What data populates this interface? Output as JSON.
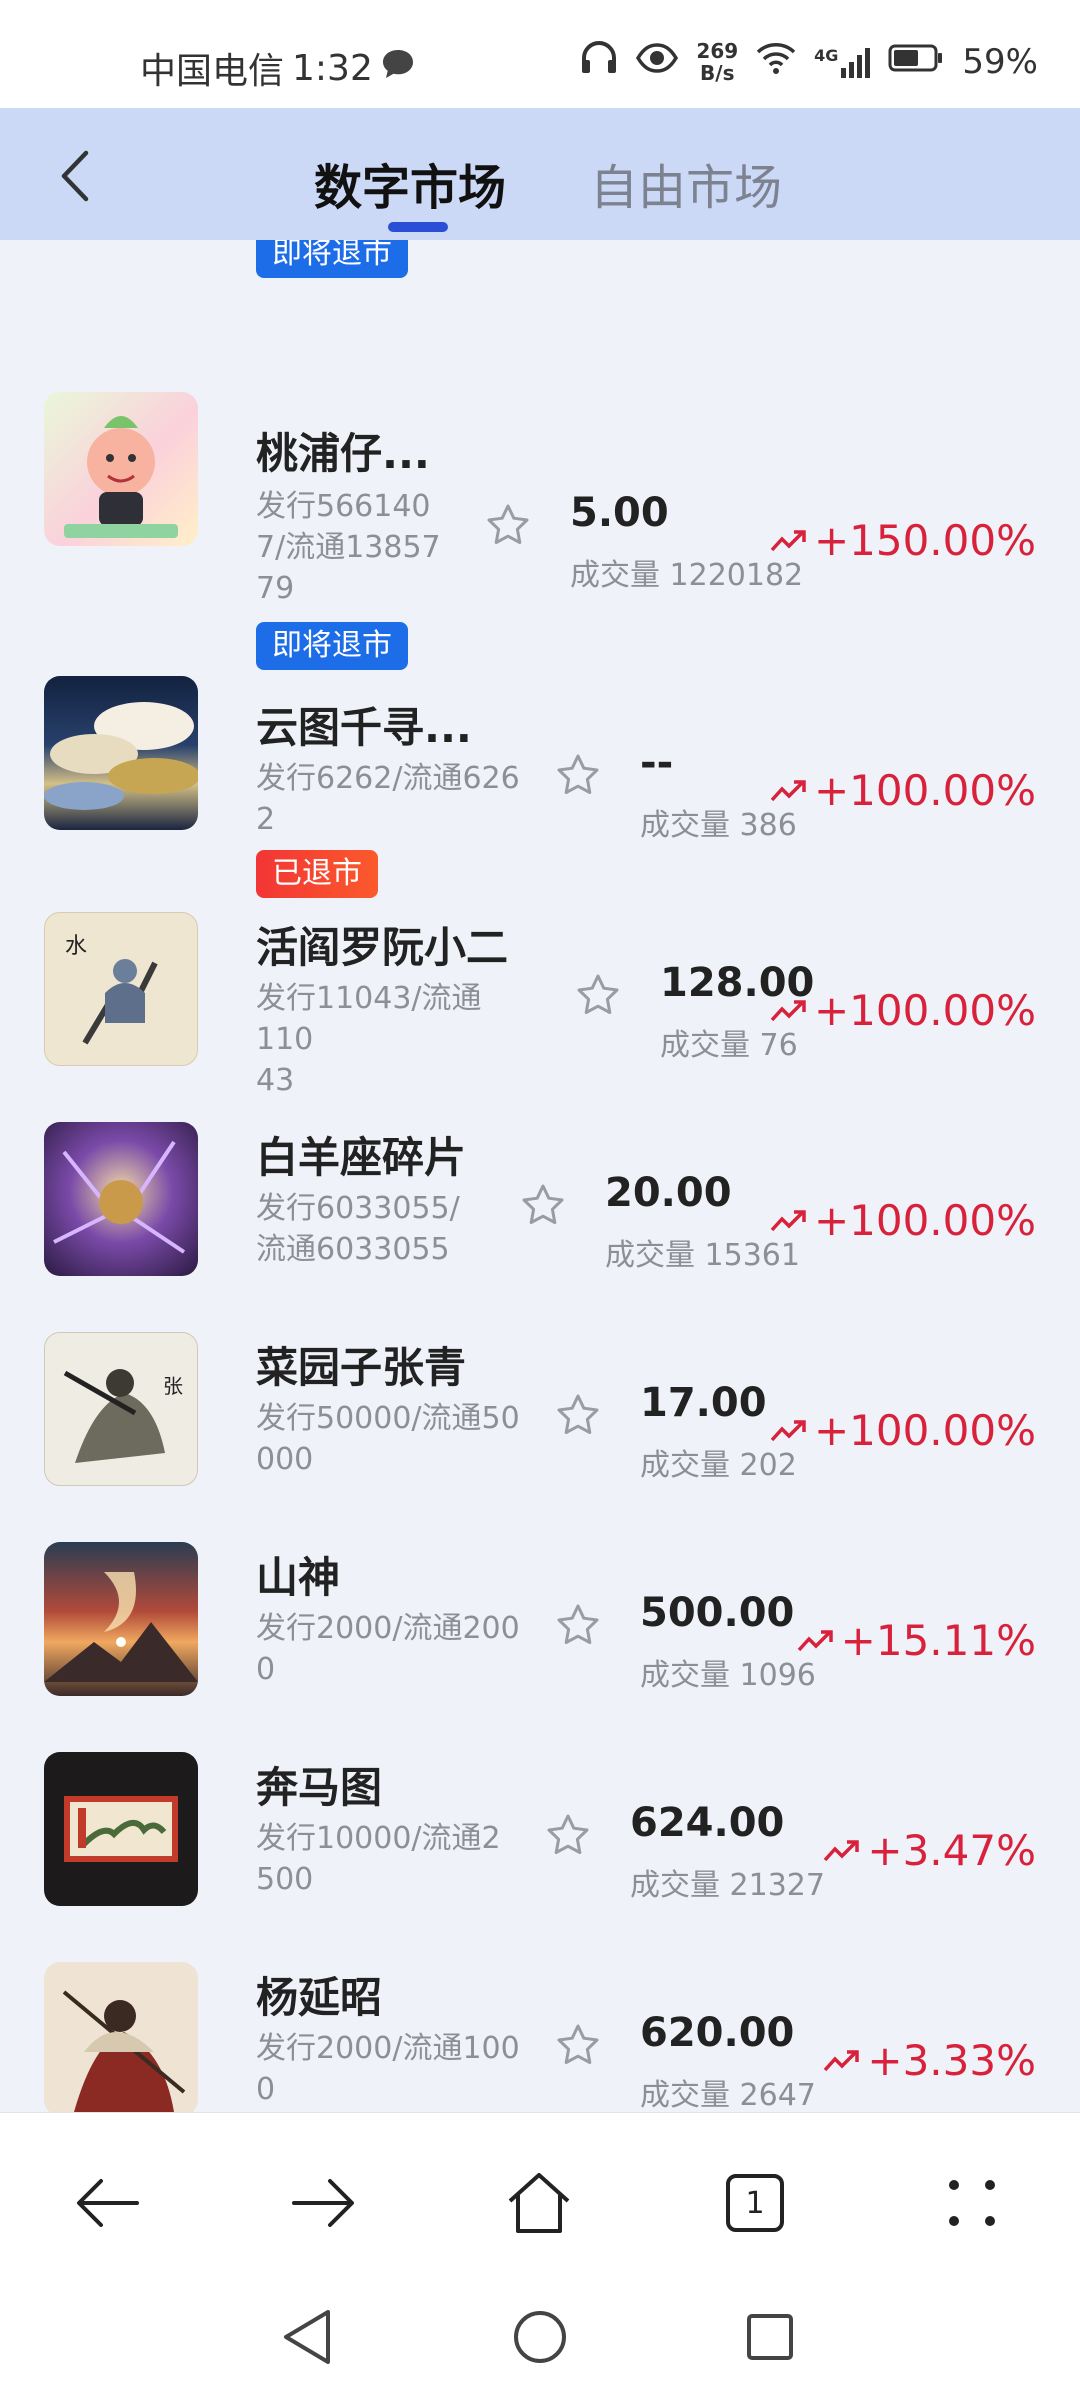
{
  "status_bar": {
    "carrier": "中国电信",
    "time": "1:32",
    "net_speed_value": "269",
    "net_speed_unit": "B/s",
    "network_type": "4G",
    "battery": "59%"
  },
  "nav": {
    "tab_active": "数字市场",
    "tab_inactive": "自由市场"
  },
  "top_partial_badge": "即将退市",
  "items": [
    {
      "name": "桃浦仔...",
      "issue": "发行566140\n7/流通13857\n79",
      "badge": "即将退市",
      "badge_type": "blue",
      "price": "5.00",
      "volume": "成交量 1220182",
      "change": "+150.00%",
      "icon": "trend-up-icon"
    },
    {
      "name": "云图千寻...",
      "issue": "发行6262/流通626\n2",
      "badge": "已退市",
      "badge_type": "red",
      "price": "--",
      "volume": "成交量 386",
      "change": "+100.00%",
      "icon": "trend-up-icon"
    },
    {
      "name": "活阎罗阮小二",
      "issue": "发行11043/流通110\n43",
      "badge": "",
      "price": "128.00",
      "volume": "成交量 76",
      "change": "+100.00%",
      "icon": "trend-up-icon"
    },
    {
      "name": "白羊座碎片",
      "issue": "发行6033055/\n流通6033055",
      "badge": "",
      "price": "20.00",
      "volume": "成交量 15361",
      "change": "+100.00%",
      "icon": "trend-up-icon"
    },
    {
      "name": "菜园子张青",
      "issue": "发行50000/流通50\n000",
      "badge": "",
      "price": "17.00",
      "volume": "成交量 202",
      "change": "+100.00%",
      "icon": "trend-up-icon"
    },
    {
      "name": "山神",
      "issue": "发行2000/流通200\n0",
      "badge": "",
      "price": "500.00",
      "volume": "成交量 1096",
      "change": "+15.11%",
      "icon": "trend-up-icon"
    },
    {
      "name": "奔马图",
      "issue": "发行10000/流通2\n500",
      "badge": "",
      "price": "624.00",
      "volume": "成交量 21327",
      "change": "+3.47%",
      "icon": "trend-up-icon"
    },
    {
      "name": "杨延昭",
      "issue": "发行2000/流通100\n0",
      "badge": "",
      "price": "620.00",
      "volume": "成交量 2647",
      "change": "+3.33%",
      "icon": "trend-up-icon"
    }
  ],
  "browser_bar": {
    "tab_count": "1"
  },
  "colors": {
    "accent": "#2a4fd6",
    "up_red": "#d8213b",
    "badge_blue": "#1d6de9",
    "badge_red": "#f23535"
  }
}
